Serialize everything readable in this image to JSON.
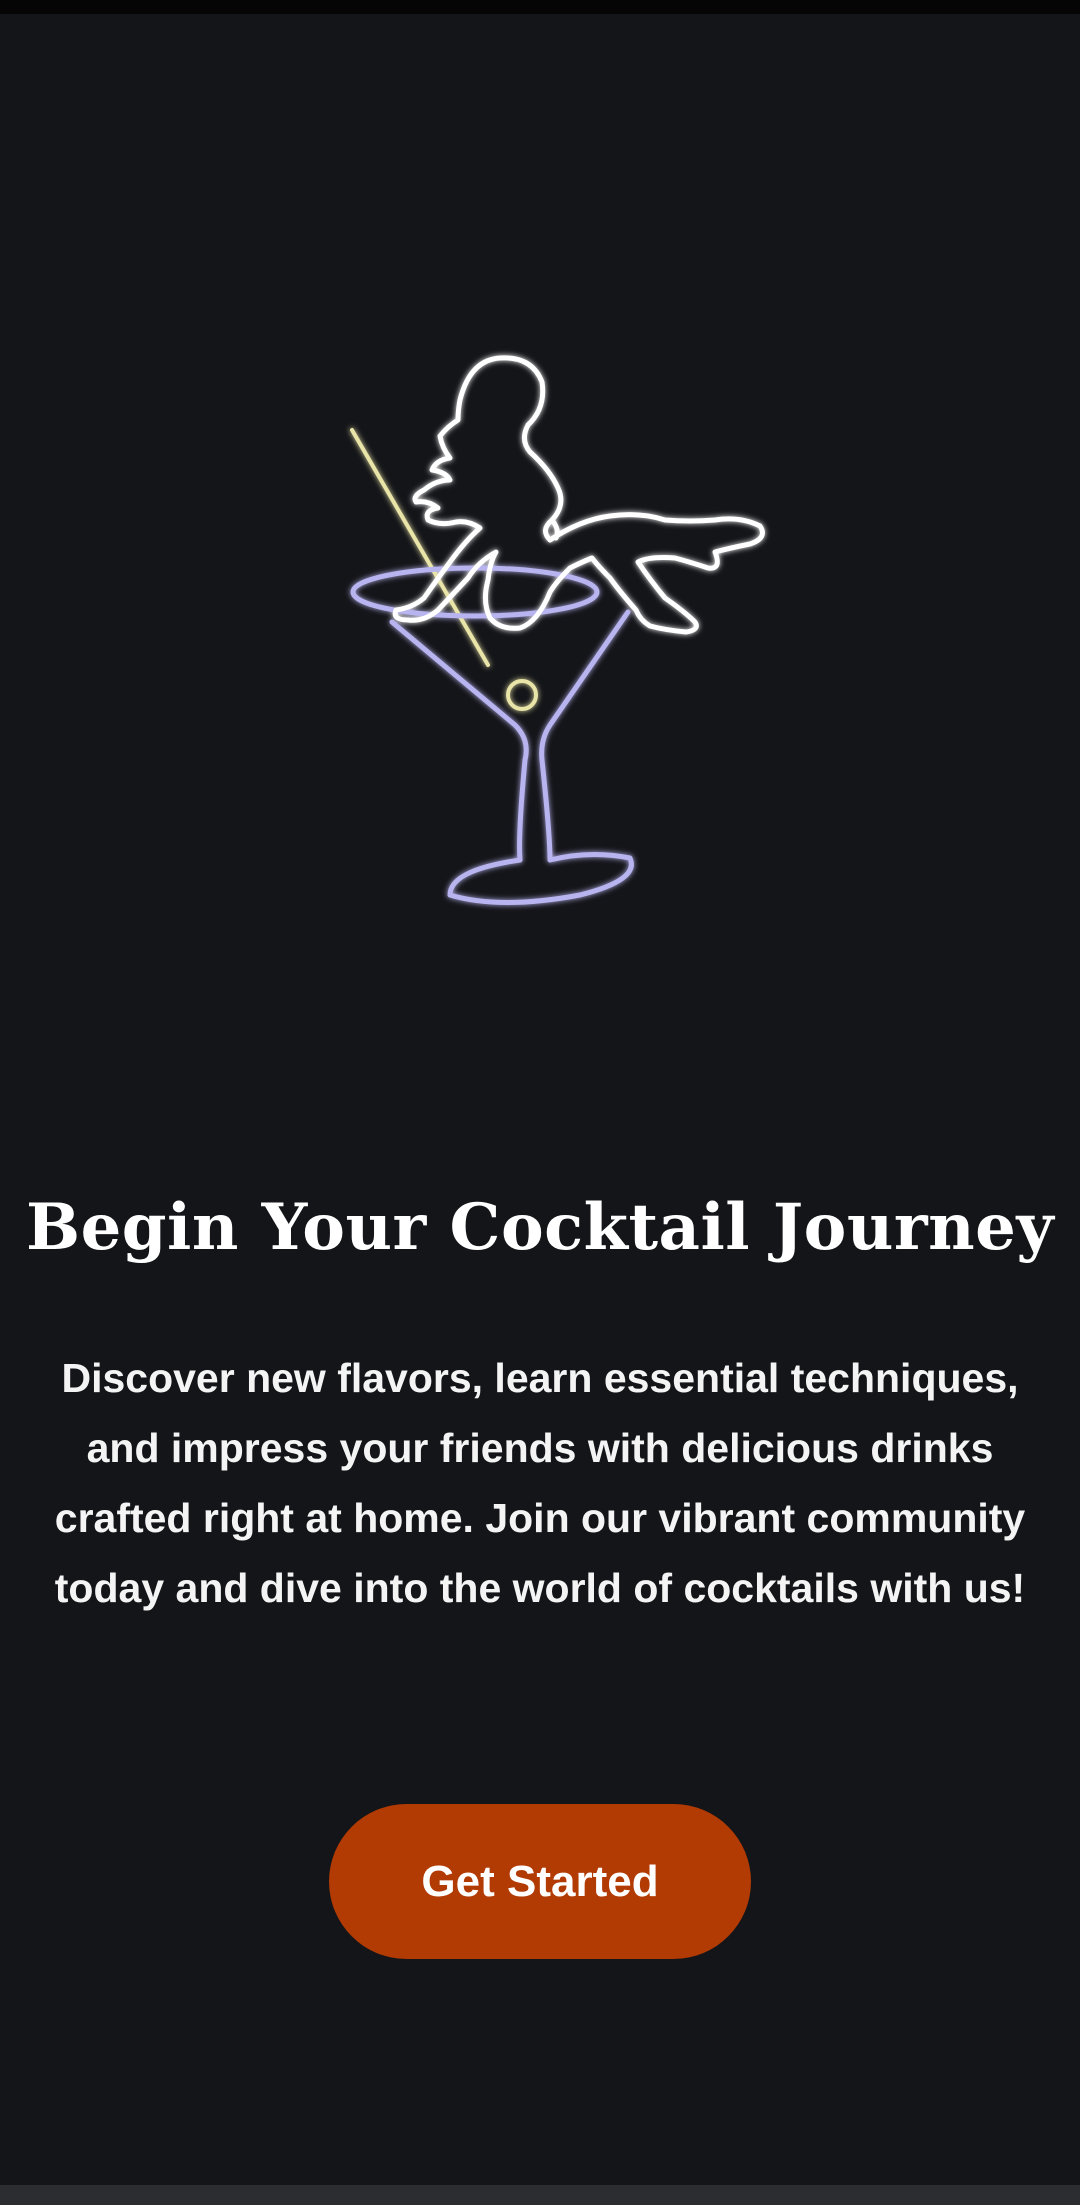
{
  "onboarding": {
    "illustration_icon": "neon-martini-glass-icon",
    "title": "Begin Your Cocktail Journey",
    "description": "Discover new flavors, learn essential techniques, and impress your friends with delicious drinks crafted right at home. Join our vibrant community today and dive into the world of cocktails with us!",
    "cta_label": "Get Started"
  },
  "colors": {
    "background": "#141519",
    "accent": "#b23a03",
    "neon_white": "#ffffff",
    "neon_lavender": "#b8b4f0",
    "neon_yellow": "#e9e4a8"
  }
}
